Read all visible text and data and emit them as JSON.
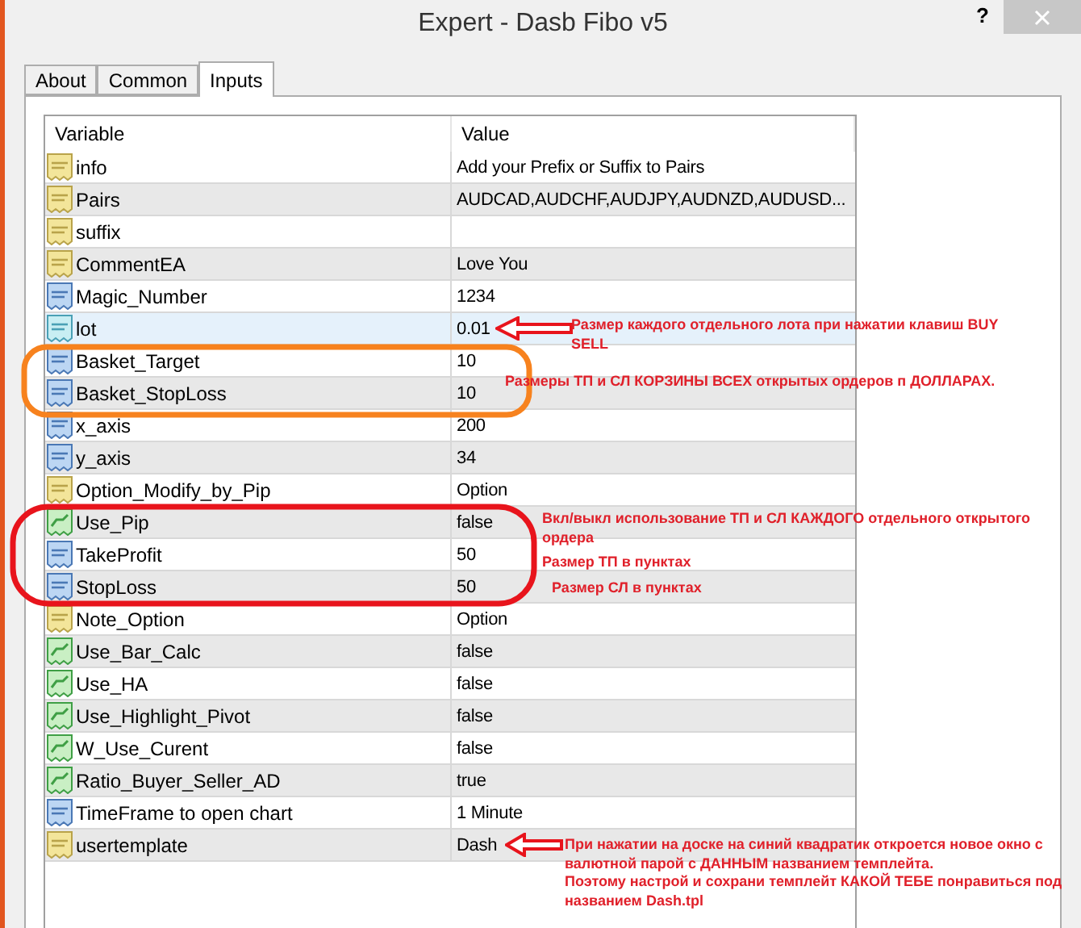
{
  "window": {
    "title": "Expert - Dasb Fibo v5",
    "help": "?"
  },
  "tabs": [
    {
      "label": "About",
      "selected": false
    },
    {
      "label": "Common",
      "selected": false
    },
    {
      "label": "Inputs",
      "selected": true
    }
  ],
  "table": {
    "columns": [
      "Variable",
      "Value"
    ],
    "rows": [
      {
        "kind": "string",
        "name": "info",
        "value": "Add your Prefix or Suffix to Pairs",
        "selected": false
      },
      {
        "kind": "string",
        "name": "Pairs",
        "value": "AUDCAD,AUDCHF,AUDJPY,AUDNZD,AUDUSD...",
        "selected": false
      },
      {
        "kind": "string",
        "name": "suffix",
        "selected": false
      },
      {
        "kind": "string",
        "name": "CommentEA",
        "value": "Love You",
        "selected": false
      },
      {
        "kind": "int",
        "name": "Magic_Number",
        "value": "1234",
        "selected": false
      },
      {
        "kind": "double",
        "name": "lot",
        "value": "0.01",
        "selected": true
      },
      {
        "kind": "int",
        "name": "Basket_Target",
        "value": "10",
        "selected": false
      },
      {
        "kind": "int",
        "name": "Basket_StopLoss",
        "value": "10",
        "selected": false
      },
      {
        "kind": "int",
        "name": "x_axis",
        "value": "200",
        "selected": false
      },
      {
        "kind": "int",
        "name": "y_axis",
        "value": "34",
        "selected": false
      },
      {
        "kind": "string",
        "name": "Option_Modify_by_Pip",
        "value": "Option",
        "selected": false
      },
      {
        "kind": "bool",
        "name": "Use_Pip",
        "value": "false",
        "selected": false
      },
      {
        "kind": "int",
        "name": "TakeProfit",
        "value": "50",
        "selected": false
      },
      {
        "kind": "int",
        "name": "StopLoss",
        "value": "50",
        "selected": false
      },
      {
        "kind": "string",
        "name": "Note_Option",
        "value": "Option",
        "selected": false
      },
      {
        "kind": "bool",
        "name": "Use_Bar_Calc",
        "value": "false",
        "selected": false
      },
      {
        "kind": "bool",
        "name": "Use_HA",
        "value": "false",
        "selected": false
      },
      {
        "kind": "bool",
        "name": "Use_Highlight_Pivot",
        "value": "false",
        "selected": false
      },
      {
        "kind": "bool",
        "name": "W_Use_Curent",
        "value": "false",
        "selected": false
      },
      {
        "kind": "bool",
        "name": "Ratio_Buyer_Seller_AD",
        "value": "true",
        "selected": false
      },
      {
        "kind": "int",
        "name": "TimeFrame to open chart",
        "value": "1 Minute",
        "selected": false
      },
      {
        "kind": "string",
        "name": "usertemplate",
        "value": "Dash",
        "selected": false
      }
    ]
  },
  "annotations": [
    {
      "lines": [
        "Размер каждого отдельного лота при нажатии клавиш BUY",
        "SELL"
      ]
    },
    {
      "lines": [
        "Размеры ТП и СЛ КОРЗИНЫ ВСЕХ открытых ордеров п ДОЛЛАРАХ."
      ]
    },
    {
      "lines": [
        "Вкл/выкл использование ТП и СЛ КАЖДОГО отдельного открытого",
        "ордера"
      ]
    },
    {
      "lines": [
        "Размер ТП в пунктах"
      ]
    },
    {
      "lines": [
        "Размер СЛ в пунктах"
      ]
    },
    {
      "lines": [
        "При нажатии на доске на синий квадратик откроется новое окно с",
        "валютной парой с ДАННЫМ названием темплейта.",
        "Поэтому настрой и сохрани темплейт КАКОЙ ТЕБЕ понравиться под",
        "названием Dash.tpl"
      ]
    }
  ]
}
